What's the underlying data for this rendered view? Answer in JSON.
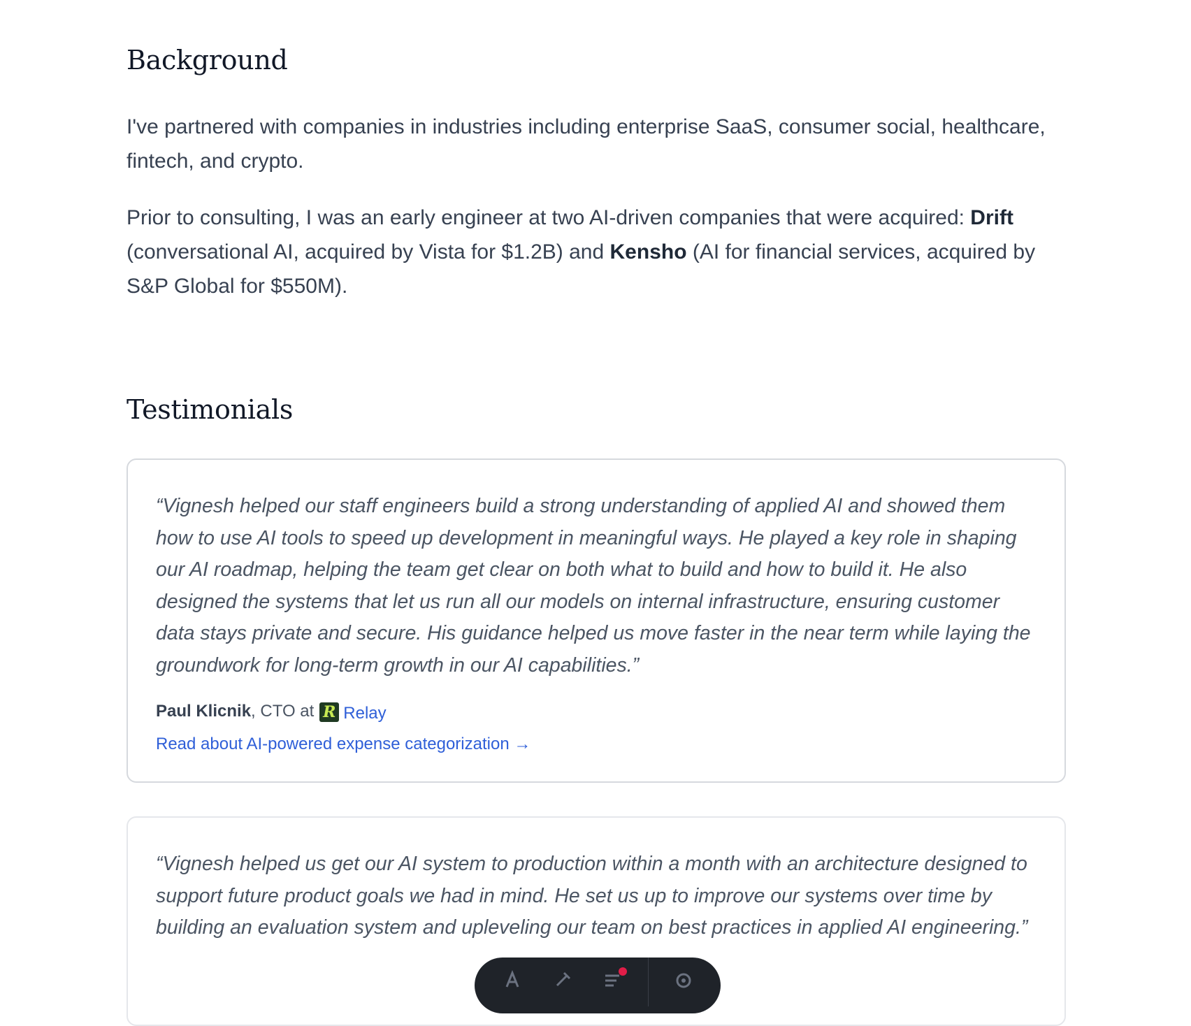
{
  "background": {
    "heading": "Background",
    "p1": "I've partnered with companies in industries including enterprise SaaS, consumer social, healthcare, fintech, and crypto.",
    "p2_a": "Prior to consulting, I was an early engineer at two AI-driven companies that were acquired: ",
    "p2_drift": "Drift",
    "p2_b": " (conversational AI, acquired by Vista for $1.2B) and ",
    "p2_kensho": "Kensho",
    "p2_c": " (AI for financial services, acquired by S&P Global for $550M)."
  },
  "testimonials": {
    "heading": "Testimonials",
    "items": [
      {
        "quote": "“Vignesh helped our staff engineers build a strong understanding of applied AI and showed them how to use AI tools to speed up development in meaningful ways. He played a key role in shaping our AI roadmap, helping the team get clear on both what to build and how to build it. He also designed the systems that let us run all our models on internal infrastructure, ensuring customer data stays private and secure. His guidance helped us move faster in the near term while laying the groundwork for long-term growth in our AI capabilities.”",
        "name": "Paul Klicnik",
        "role": ", CTO at",
        "company": "Relay",
        "company_logo_letter": "R",
        "link": "Read about AI-powered expense categorization →"
      },
      {
        "quote": "“Vignesh helped us get our AI system to production within a month with an architecture designed to support future product goals we had in mind. He set us up to improve our systems over time by building an evaluation system and upleveling our team on best practices in applied AI engineering.”"
      }
    ]
  },
  "toolbar": {
    "items": [
      "text-tool-icon",
      "pen-tool-icon",
      "comments-icon",
      "settings-icon"
    ],
    "notification_color": "#e11d48"
  }
}
